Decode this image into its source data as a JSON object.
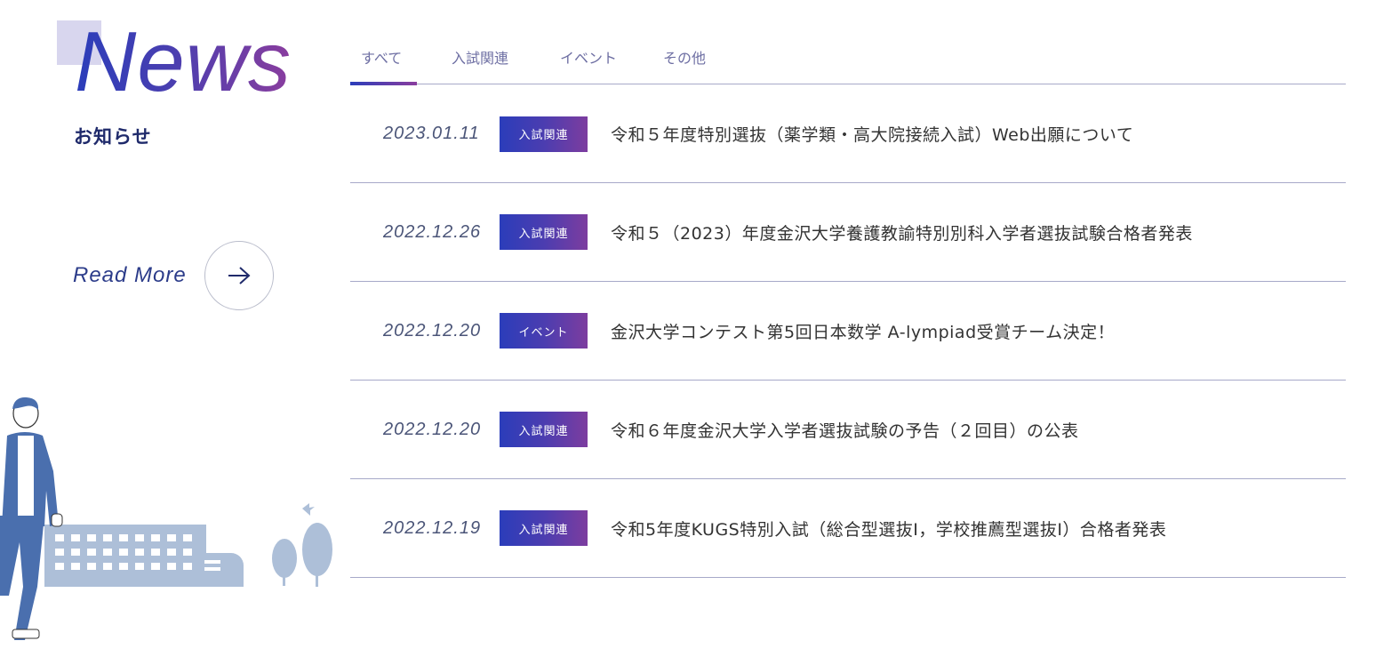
{
  "header": {
    "title": "News",
    "subtitle": "お知らせ"
  },
  "read_more": {
    "label": "Read More",
    "icon": "arrow-right-icon"
  },
  "tabs": [
    {
      "label": "すべて",
      "active": true
    },
    {
      "label": "入試関連",
      "active": false
    },
    {
      "label": "イベント",
      "active": false
    },
    {
      "label": "その他",
      "active": false
    }
  ],
  "news": [
    {
      "date": "2023.01.11",
      "category": "入試関連",
      "title": "令和５年度特別選抜（薬学類・高大院接続入試）Web出願について"
    },
    {
      "date": "2022.12.26",
      "category": "入試関連",
      "title": "令和５（2023）年度金沢大学養護教諭特別別科入学者選抜試験合格者発表"
    },
    {
      "date": "2022.12.20",
      "category": "イベント",
      "title": "金沢大学コンテスト第5回日本数学 A-lympiad受賞チーム決定！"
    },
    {
      "date": "2022.12.20",
      "category": "入試関連",
      "title": "令和６年度金沢大学入学者選抜試験の予告（２回目）の公表"
    },
    {
      "date": "2022.12.19",
      "category": "入試関連",
      "title": "令和5年度KUGS特別入試（総合型選抜Ⅰ，学校推薦型選抜Ⅰ）合格者発表"
    }
  ],
  "colors": {
    "accent_start": "#2b3dba",
    "accent_end": "#8a3d9e",
    "divider": "#a7a9c9",
    "illustration": "#adbfd8",
    "person": "#4a6fae"
  }
}
